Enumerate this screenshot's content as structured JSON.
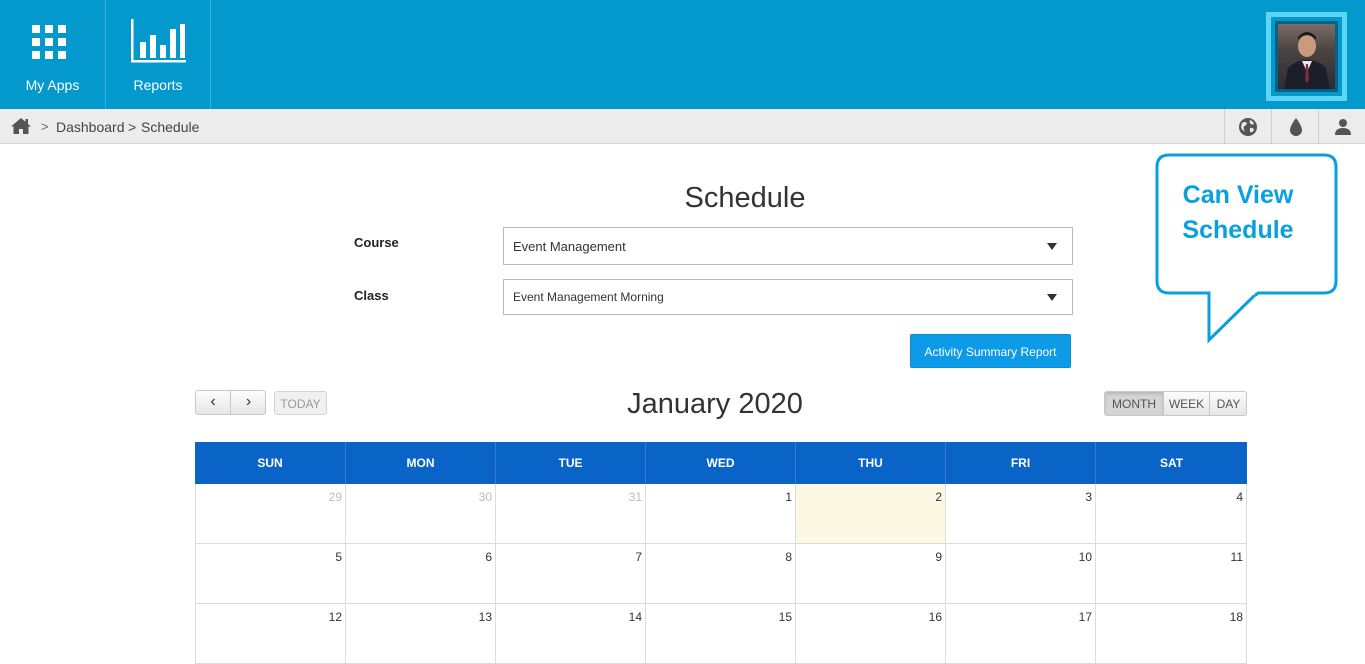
{
  "topbar": {
    "apps_label": "My Apps",
    "reports_label": "Reports",
    "color": "#0399cc"
  },
  "breadcrumb": {
    "home_icon": "home-icon",
    "separator_chevron": ">",
    "dashboard": "Dashboard",
    "separator": ">",
    "current": "Schedule"
  },
  "utility_icons": [
    "globe-icon",
    "drop-icon",
    "user-icon"
  ],
  "page": {
    "title": "Schedule"
  },
  "form": {
    "course_label": "Course",
    "course_value": "Event Management",
    "class_label": "Class",
    "class_value": "Event Management Morning",
    "report_button": "Activity Summary Report"
  },
  "callout": {
    "line1": "Can View",
    "line2": "Schedule",
    "color": "#0aa0df"
  },
  "calendar": {
    "prev": "‹",
    "next": "›",
    "today": "TODAY",
    "title": "January 2020",
    "views": {
      "month": "MONTH",
      "week": "WEEK",
      "day": "DAY",
      "active": "month"
    },
    "weekdays": [
      "SUN",
      "MON",
      "TUE",
      "WED",
      "THU",
      "FRI",
      "SAT"
    ],
    "header_color": "#0a64c8",
    "weeks": [
      [
        {
          "d": "29",
          "other": true
        },
        {
          "d": "30",
          "other": true
        },
        {
          "d": "31",
          "other": true
        },
        {
          "d": "1"
        },
        {
          "d": "2",
          "today": true
        },
        {
          "d": "3"
        },
        {
          "d": "4"
        }
      ],
      [
        {
          "d": "5"
        },
        {
          "d": "6"
        },
        {
          "d": "7"
        },
        {
          "d": "8"
        },
        {
          "d": "9"
        },
        {
          "d": "10"
        },
        {
          "d": "11"
        }
      ],
      [
        {
          "d": "12"
        },
        {
          "d": "13"
        },
        {
          "d": "14"
        },
        {
          "d": "15"
        },
        {
          "d": "16"
        },
        {
          "d": "17"
        },
        {
          "d": "18"
        }
      ]
    ]
  }
}
